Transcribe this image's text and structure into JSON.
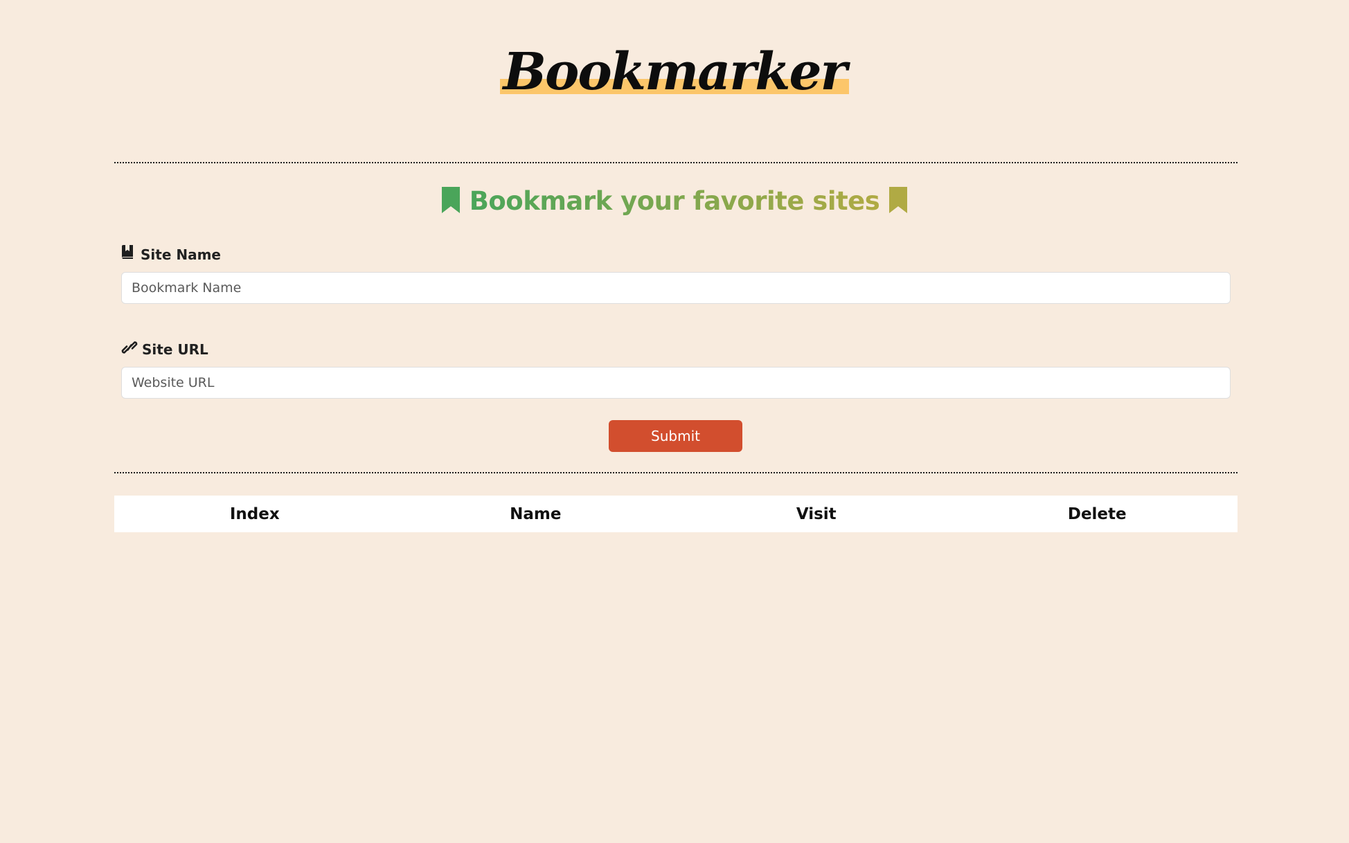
{
  "header": {
    "title": "Bookmarker",
    "tagline": "Bookmark your favorite sites"
  },
  "form": {
    "site_name": {
      "label": "Site Name",
      "placeholder": "Bookmark Name",
      "value": "",
      "icon": "book-bookmark-icon"
    },
    "site_url": {
      "label": "Site URL",
      "placeholder": "Website URL",
      "value": "",
      "icon": "link-icon"
    },
    "submit_label": "Submit"
  },
  "table": {
    "columns": [
      "Index",
      "Name",
      "Visit",
      "Delete"
    ],
    "rows": []
  },
  "colors": {
    "background": "#f8ebde",
    "logo_highlight": "#fcc66a",
    "tagline_start": "#4aa55a",
    "tagline_end": "#b0aa44",
    "submit": "#d24e2e"
  }
}
